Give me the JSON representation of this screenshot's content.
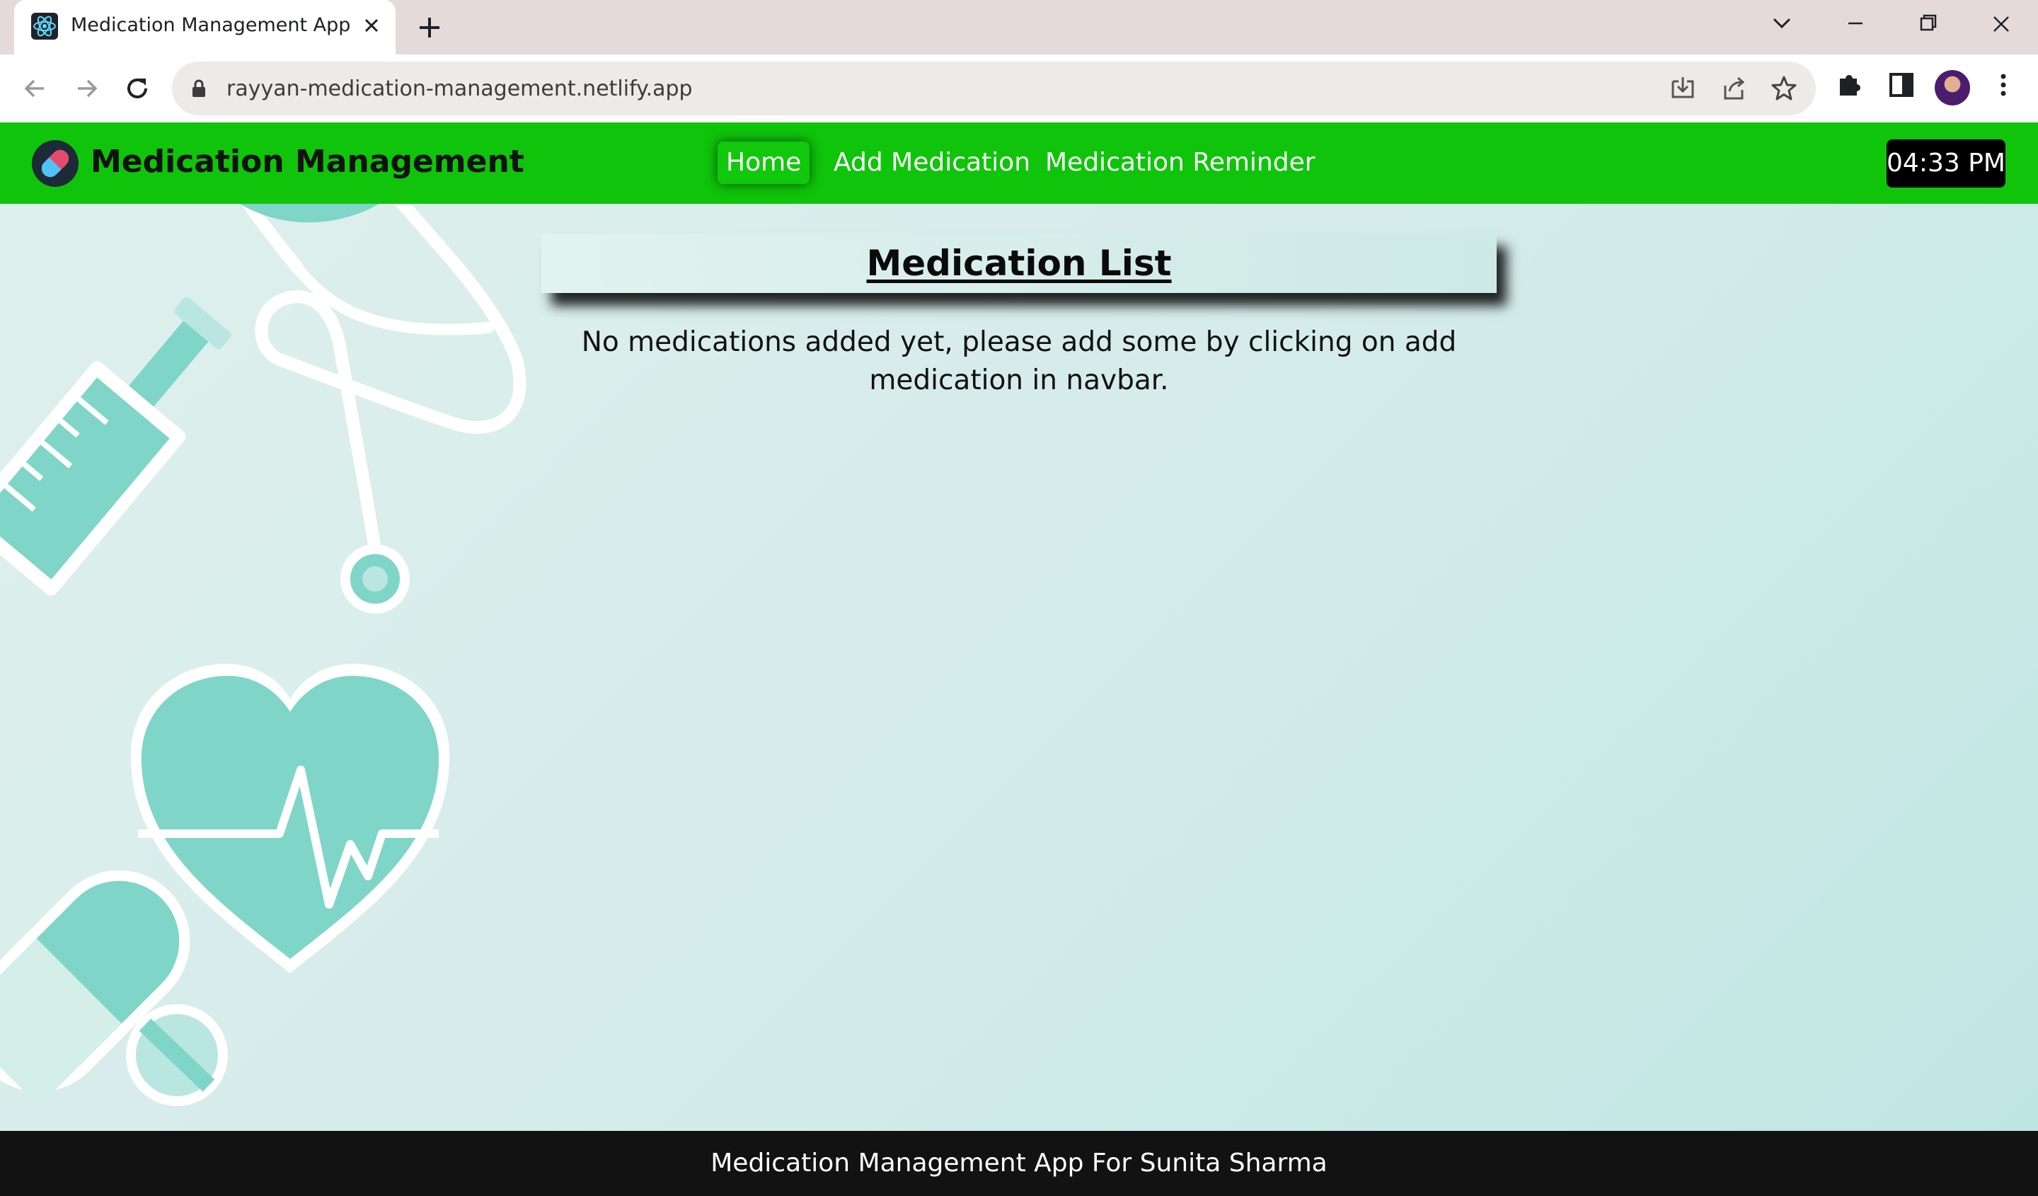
{
  "browser": {
    "tab_title": "Medication Management App",
    "url": "rayyan-medication-management.netlify.app",
    "icons": [
      "react-favicon",
      "close-icon",
      "plus-icon",
      "chevron-down-icon",
      "minimize-icon",
      "restore-icon",
      "close-window-icon",
      "back-arrow-icon",
      "forward-arrow-icon",
      "reload-icon",
      "lock-icon",
      "install-icon",
      "share-icon",
      "star-icon",
      "extensions-icon",
      "sidebar-icon",
      "avatar",
      "kebab-menu-icon"
    ]
  },
  "app": {
    "brand": "Medication Management",
    "nav": {
      "home": "Home",
      "add_medication": "Add Medication",
      "reminder": "Medication Reminder"
    },
    "clock": "04:33 PM",
    "list_title": "Medication List",
    "empty_message": "No medications added yet, please add some by clicking on add medication in navbar.",
    "footer": "Medication Management App For Sunita Sharma",
    "colors": {
      "navbar": "#0fc40a",
      "clock_bg": "#000000",
      "footer_bg": "#121212",
      "decor_teal": "#7fd5c8"
    }
  }
}
